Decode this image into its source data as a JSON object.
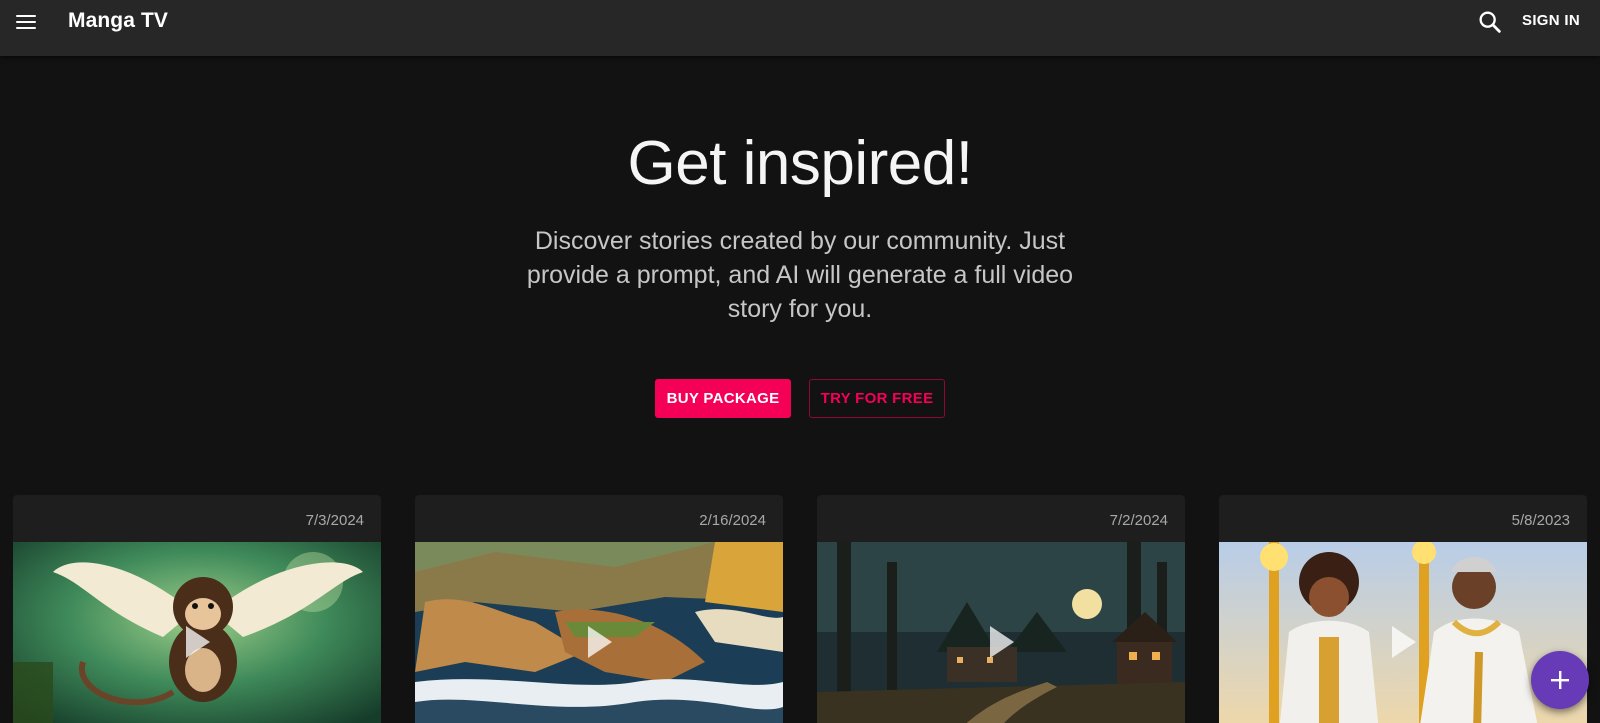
{
  "appbar": {
    "title": "Manga TV",
    "menu_icon": "menu-icon",
    "search_icon": "search-icon",
    "signin_label": "SIGN IN"
  },
  "hero": {
    "title": "Get inspired!",
    "subtitle": "Discover stories created by our community. Just provide a prompt, and AI will generate a full video story for you.",
    "buy_label": "BUY PACKAGE",
    "try_label": "TRY FOR FREE"
  },
  "cards": [
    {
      "date": "7/3/2024",
      "thumbnail": "winged-monkey-jungle"
    },
    {
      "date": "2/16/2024",
      "thumbnail": "coastal-cliffs-ocean"
    },
    {
      "date": "7/2/2024",
      "thumbnail": "forest-village-night-moon"
    },
    {
      "date": "5/8/2023",
      "thumbnail": "two-warriors-golden-staffs"
    }
  ],
  "fab": {
    "icon": "plus-icon"
  },
  "colors": {
    "accent": "#f50057",
    "fab": "#673ab7",
    "appbar": "#272727",
    "background": "#121212",
    "card": "#1e1e1e"
  }
}
